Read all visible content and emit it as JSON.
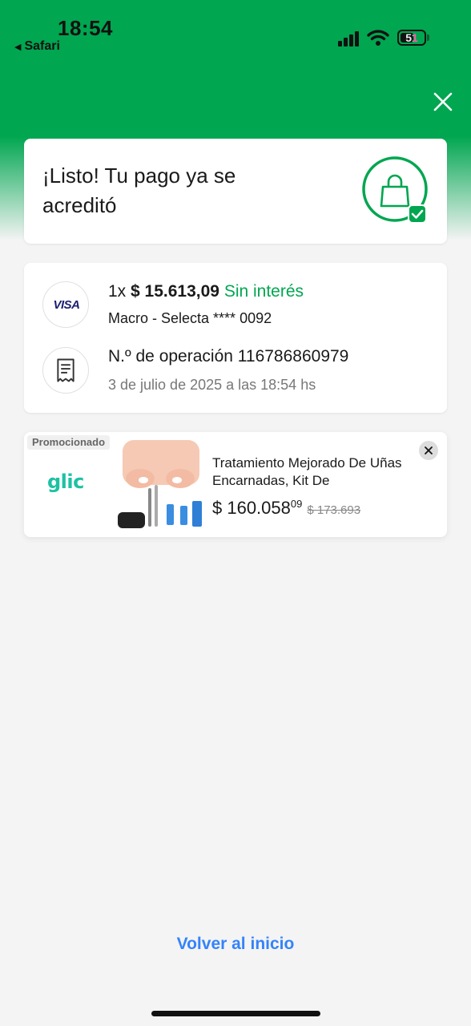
{
  "status_bar": {
    "time": "18:54",
    "back_app": "Safari",
    "battery": "51"
  },
  "success": {
    "title": "¡Listo! Tu pago ya se acreditó"
  },
  "payment": {
    "card_brand": "VISA",
    "installments": "1x",
    "amount": "$ 15.613,09",
    "interest": "Sin interés",
    "card_detail": "Macro - Selecta **** 0092",
    "operation_label": "N.º de operación 116786860979",
    "date": "3 de julio de 2025 a las 18:54 hs"
  },
  "ad": {
    "tag": "Promocionado",
    "brand": "glic",
    "title": "Tratamiento Mejorado De Uñas Encarnadas, Kit De",
    "price_main": "$ 160.058",
    "price_cents": "09",
    "price_old": "$ 173.693"
  },
  "footer": {
    "home_link": "Volver al inicio"
  },
  "colors": {
    "brand_green": "#00a650",
    "link_blue": "#3483fa",
    "page_bg": "#f4f4f4"
  },
  "icons": {
    "close": "close-icon",
    "success": "shopping-bag-check-icon",
    "receipt": "receipt-icon",
    "ad_close": "close-icon"
  }
}
